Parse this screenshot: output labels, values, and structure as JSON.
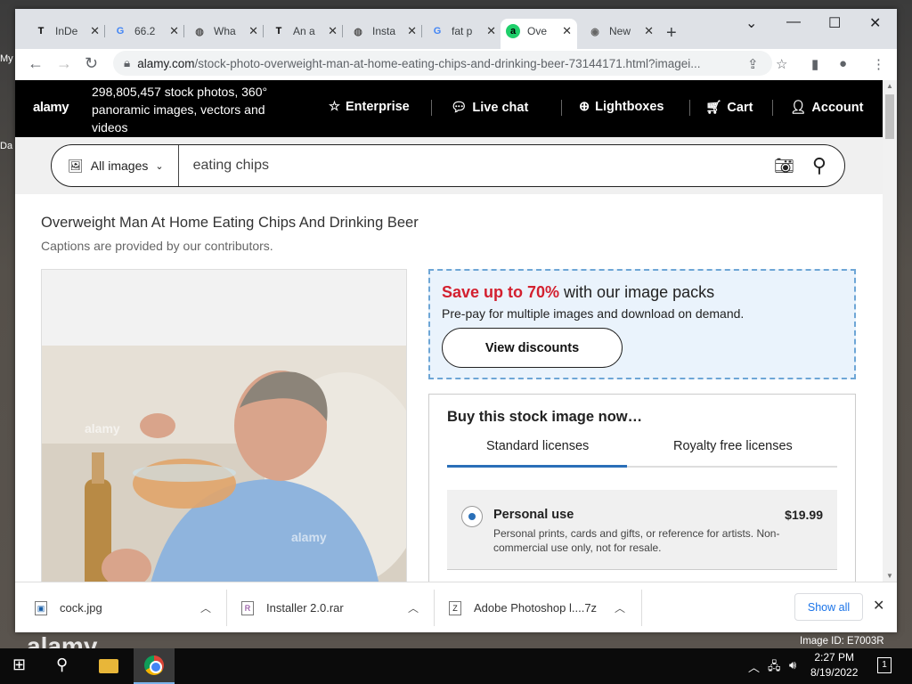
{
  "desktop": {
    "labels": [
      "My",
      "Da"
    ]
  },
  "browser": {
    "tabs": [
      {
        "title": "InDe",
        "favicon": "T"
      },
      {
        "title": "66.2",
        "favicon": "G"
      },
      {
        "title": "Wha",
        "favicon": "globe"
      },
      {
        "title": "An a",
        "favicon": "T"
      },
      {
        "title": "Insta",
        "favicon": "globe"
      },
      {
        "title": "fat p",
        "favicon": "G"
      },
      {
        "title": "Ove",
        "favicon": "a",
        "active": true
      },
      {
        "title": "New",
        "favicon": "chrome"
      }
    ],
    "url_domain": "alamy.com",
    "url_path": "/stock-photo-overweight-man-at-home-eating-chips-and-drinking-beer-73144171.html?imagei..."
  },
  "site": {
    "logo": "alamy",
    "tagline": "298,805,457 stock photos, 360° panoramic images, vectors and videos",
    "nav": {
      "enterprise": "Enterprise",
      "live_chat": "Live chat",
      "lightboxes": "Lightboxes",
      "cart": "Cart",
      "account": "Account"
    },
    "search": {
      "category": "All images",
      "value": "eating chips"
    },
    "title": "Overweight Man At Home Eating Chips And Drinking Beer",
    "caption": "Captions are provided by our contributors.",
    "promo": {
      "highlight": "Save up to 70%",
      "headline_rest": " with our image packs",
      "sub": "Pre-pay for multiple images and download on demand.",
      "button": "View discounts"
    },
    "buy": {
      "heading": "Buy this stock image now…",
      "tab_standard": "Standard licenses",
      "tab_royalty": "Royalty free licenses",
      "option_name": "Personal use",
      "option_price": "$19.99",
      "option_desc": "Personal prints, cards and gifts, or reference for artists. Non-commercial use only, not for resale."
    },
    "photo_watermark": "alamy"
  },
  "downloads": {
    "items": [
      "cock.jpg",
      "Installer 2.0.rar",
      "Adobe Photoshop l....7z"
    ],
    "show_all": "Show all"
  },
  "overlay": {
    "watermark": "alamy",
    "image_id": "Image ID: E7003R"
  },
  "taskbar": {
    "time": "2:27 PM",
    "date": "8/19/2022",
    "notifications": "1"
  }
}
